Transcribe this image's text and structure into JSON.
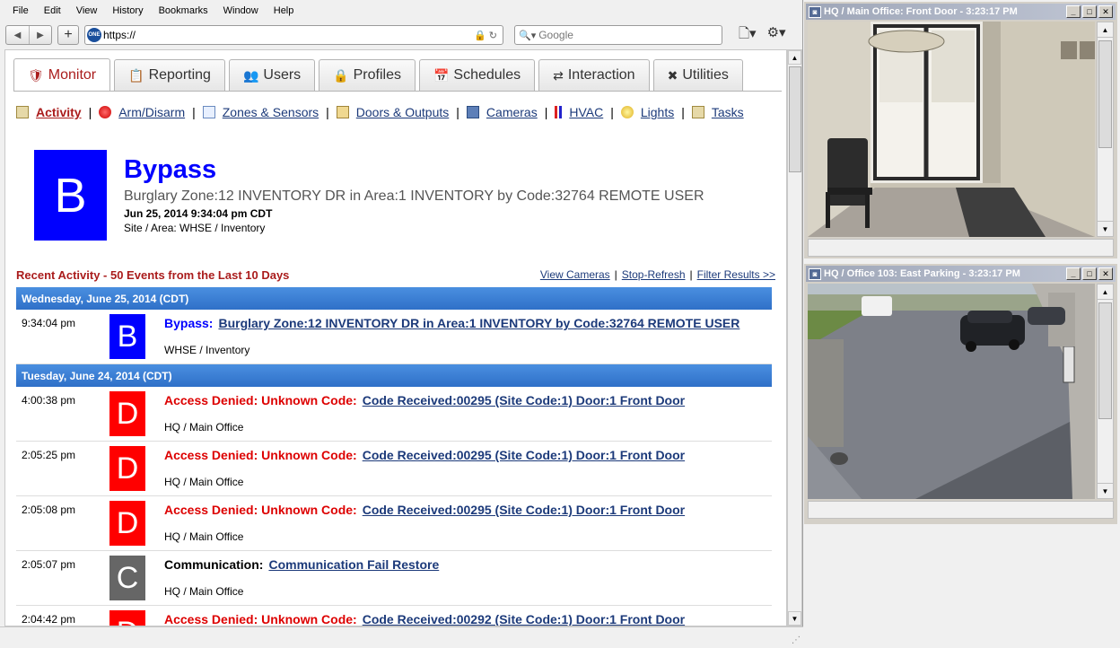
{
  "browser": {
    "menu": [
      "File",
      "Edit",
      "View",
      "History",
      "Bookmarks",
      "Window",
      "Help"
    ],
    "url": "https://",
    "search_placeholder": "Google"
  },
  "tabs": [
    {
      "label": "Monitor",
      "icon": "shield-icon",
      "active": true
    },
    {
      "label": "Reporting",
      "icon": "report-icon",
      "active": false
    },
    {
      "label": "Users",
      "icon": "users-icon",
      "active": false
    },
    {
      "label": "Profiles",
      "icon": "lock-icon",
      "active": false
    },
    {
      "label": "Schedules",
      "icon": "calendar-icon",
      "active": false
    },
    {
      "label": "Interaction",
      "icon": "arrows-icon",
      "active": false
    },
    {
      "label": "Utilities",
      "icon": "tools-icon",
      "active": false
    }
  ],
  "subnav": [
    {
      "label": "Activity",
      "icon": "clipboard-icon",
      "current": true
    },
    {
      "label": "Arm/Disarm",
      "icon": "alarm-icon",
      "current": false
    },
    {
      "label": "Zones & Sensors",
      "icon": "document-icon",
      "current": false
    },
    {
      "label": "Doors & Outputs",
      "icon": "door-icon",
      "current": false
    },
    {
      "label": "Cameras",
      "icon": "camera-icon",
      "current": false
    },
    {
      "label": "HVAC",
      "icon": "thermometer-icon",
      "current": false
    },
    {
      "label": "Lights",
      "icon": "lightbulb-icon",
      "current": false
    },
    {
      "label": "Tasks",
      "icon": "clipboard-icon",
      "current": false
    }
  ],
  "hero": {
    "badge": "B",
    "title": "Bypass",
    "description": "Burglary Zone:12 INVENTORY DR in Area:1 INVENTORY by Code:32764 REMOTE USER",
    "datetime": "Jun 25, 2014 9:34:04 pm CDT",
    "site": "Site / Area: WHSE / Inventory"
  },
  "recent": {
    "title": "Recent Activity - 50 Events from the Last 10 Days",
    "links": [
      "View Cameras",
      "Stop-Refresh",
      "Filter Results >>"
    ]
  },
  "days": [
    {
      "header": "Wednesday, June 25, 2014 (CDT)",
      "events": [
        {
          "time": "9:34:04 pm",
          "badge": "B",
          "badge_color": "#0000ff",
          "label": "Bypass:",
          "label_color": "#0000ff",
          "detail": "Burglary Zone:12 INVENTORY DR in Area:1 INVENTORY by Code:32764 REMOTE USER",
          "site": "WHSE / Inventory"
        }
      ]
    },
    {
      "header": "Tuesday, June 24, 2014 (CDT)",
      "events": [
        {
          "time": "4:00:38 pm",
          "badge": "D",
          "badge_color": "#ff0000",
          "label": "Access Denied: Unknown Code:",
          "label_color": "#dd0000",
          "detail": "Code Received:00295 (Site Code:1) Door:1 Front Door",
          "site": "HQ / Main Office"
        },
        {
          "time": "2:05:25 pm",
          "badge": "D",
          "badge_color": "#ff0000",
          "label": "Access Denied: Unknown Code:",
          "label_color": "#dd0000",
          "detail": "Code Received:00295 (Site Code:1) Door:1 Front Door",
          "site": "HQ / Main Office"
        },
        {
          "time": "2:05:08 pm",
          "badge": "D",
          "badge_color": "#ff0000",
          "label": "Access Denied: Unknown Code:",
          "label_color": "#dd0000",
          "detail": "Code Received:00295 (Site Code:1) Door:1 Front Door",
          "site": "HQ / Main Office"
        },
        {
          "time": "2:05:07 pm",
          "badge": "C",
          "badge_color": "#666666",
          "label": "Communication:",
          "label_color": "#000000",
          "detail": "Communication Fail Restore",
          "site": "HQ / Main Office"
        },
        {
          "time": "2:04:42 pm",
          "badge": "D",
          "badge_color": "#ff0000",
          "label": "Access Denied: Unknown Code:",
          "label_color": "#dd0000",
          "detail": "Code Received:00292 (Site Code:1) Door:1 Front Door",
          "site": ""
        }
      ]
    }
  ],
  "cameras": [
    {
      "title": "HQ / Main Office: Front Door - 3:23:17 PM"
    },
    {
      "title": "HQ / Office 103: East Parking - 3:23:17 PM"
    }
  ]
}
